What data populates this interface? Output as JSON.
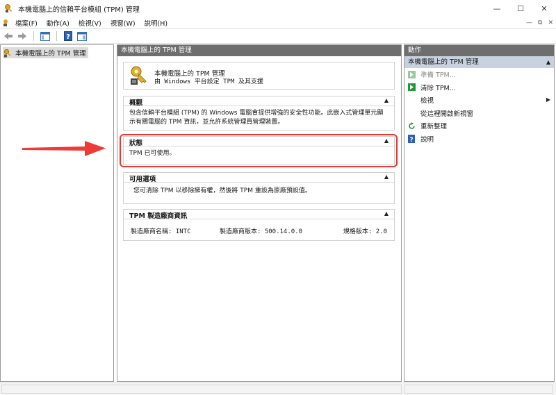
{
  "window": {
    "title": "本機電腦上的信賴平台模組 (TPM) 管理",
    "minimize": "—",
    "maximize": "☐",
    "close": "✕"
  },
  "menu": {
    "items": [
      "檔案(F)",
      "動作(A)",
      "檢視(V)",
      "視窗(W)",
      "說明(H)"
    ],
    "mdi": [
      "—",
      "⧉",
      "✕"
    ]
  },
  "tree": {
    "root_label": "本機電腦上的 TPM 管理"
  },
  "center": {
    "header": "本機電腦上的 TPM 管理",
    "summary_line1": "本機電腦上的 TPM 管理",
    "summary_line2": "由 Windows 平台設定 TPM 及其支援",
    "sections": [
      {
        "title": "概觀",
        "body": "包含信賴平台模組 (TPM) 的 Windows 電腦會提供增強的安全性功能。此嵌入式管理單元顯示有關電腦的 TPM 資訊，並允許系統管理員管理裝置。"
      },
      {
        "title": "狀態",
        "body": "TPM 已可使用。"
      },
      {
        "title": "可用選項",
        "body": "您可清除 TPM 以移除擁有權，然後將 TPM 重設為原廠預設值。"
      },
      {
        "title": "TPM 製造廠商資訊",
        "vendor_name": "製造廠商名稱: INTC",
        "vendor_version": "製造廠商版本: 500.14.0.0",
        "spec_version": "規格版本: 2.0"
      }
    ]
  },
  "actions": {
    "header": "動作",
    "sub_header": "本機電腦上的 TPM 管理",
    "items": [
      {
        "label": "準備 TPM...",
        "disabled": true,
        "icon": "green-arrow-icon"
      },
      {
        "label": "清除 TPM...",
        "disabled": false,
        "icon": "green-arrow-icon"
      },
      {
        "label": "檢視",
        "disabled": false,
        "icon": "",
        "submenu": true
      },
      {
        "label": "從這裡開啟新視窗",
        "disabled": false,
        "icon": ""
      },
      {
        "label": "重新整理",
        "disabled": false,
        "icon": "refresh-icon"
      },
      {
        "label": "說明",
        "disabled": false,
        "icon": "help-icon"
      }
    ]
  },
  "colors": {
    "highlight": "#e53935",
    "pane_header": "#6e6e6e",
    "action_sub": "#c7d1e0"
  }
}
